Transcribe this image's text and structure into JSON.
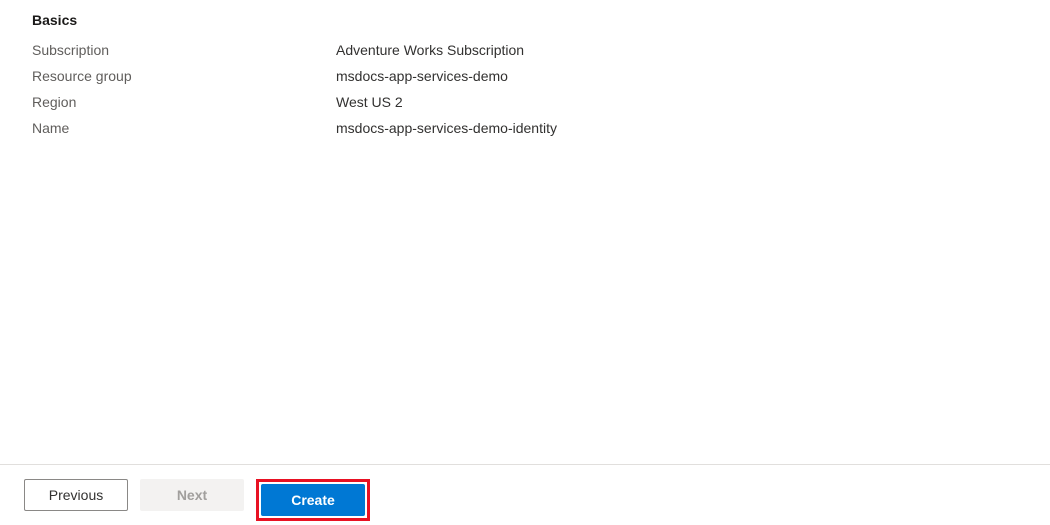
{
  "section": {
    "heading": "Basics",
    "rows": [
      {
        "label": "Subscription",
        "value": "Adventure Works Subscription"
      },
      {
        "label": "Resource group",
        "value": "msdocs-app-services-demo"
      },
      {
        "label": "Region",
        "value": "West US 2"
      },
      {
        "label": "Name",
        "value": "msdocs-app-services-demo-identity"
      }
    ]
  },
  "footer": {
    "previous": "Previous",
    "next": "Next",
    "create": "Create"
  }
}
